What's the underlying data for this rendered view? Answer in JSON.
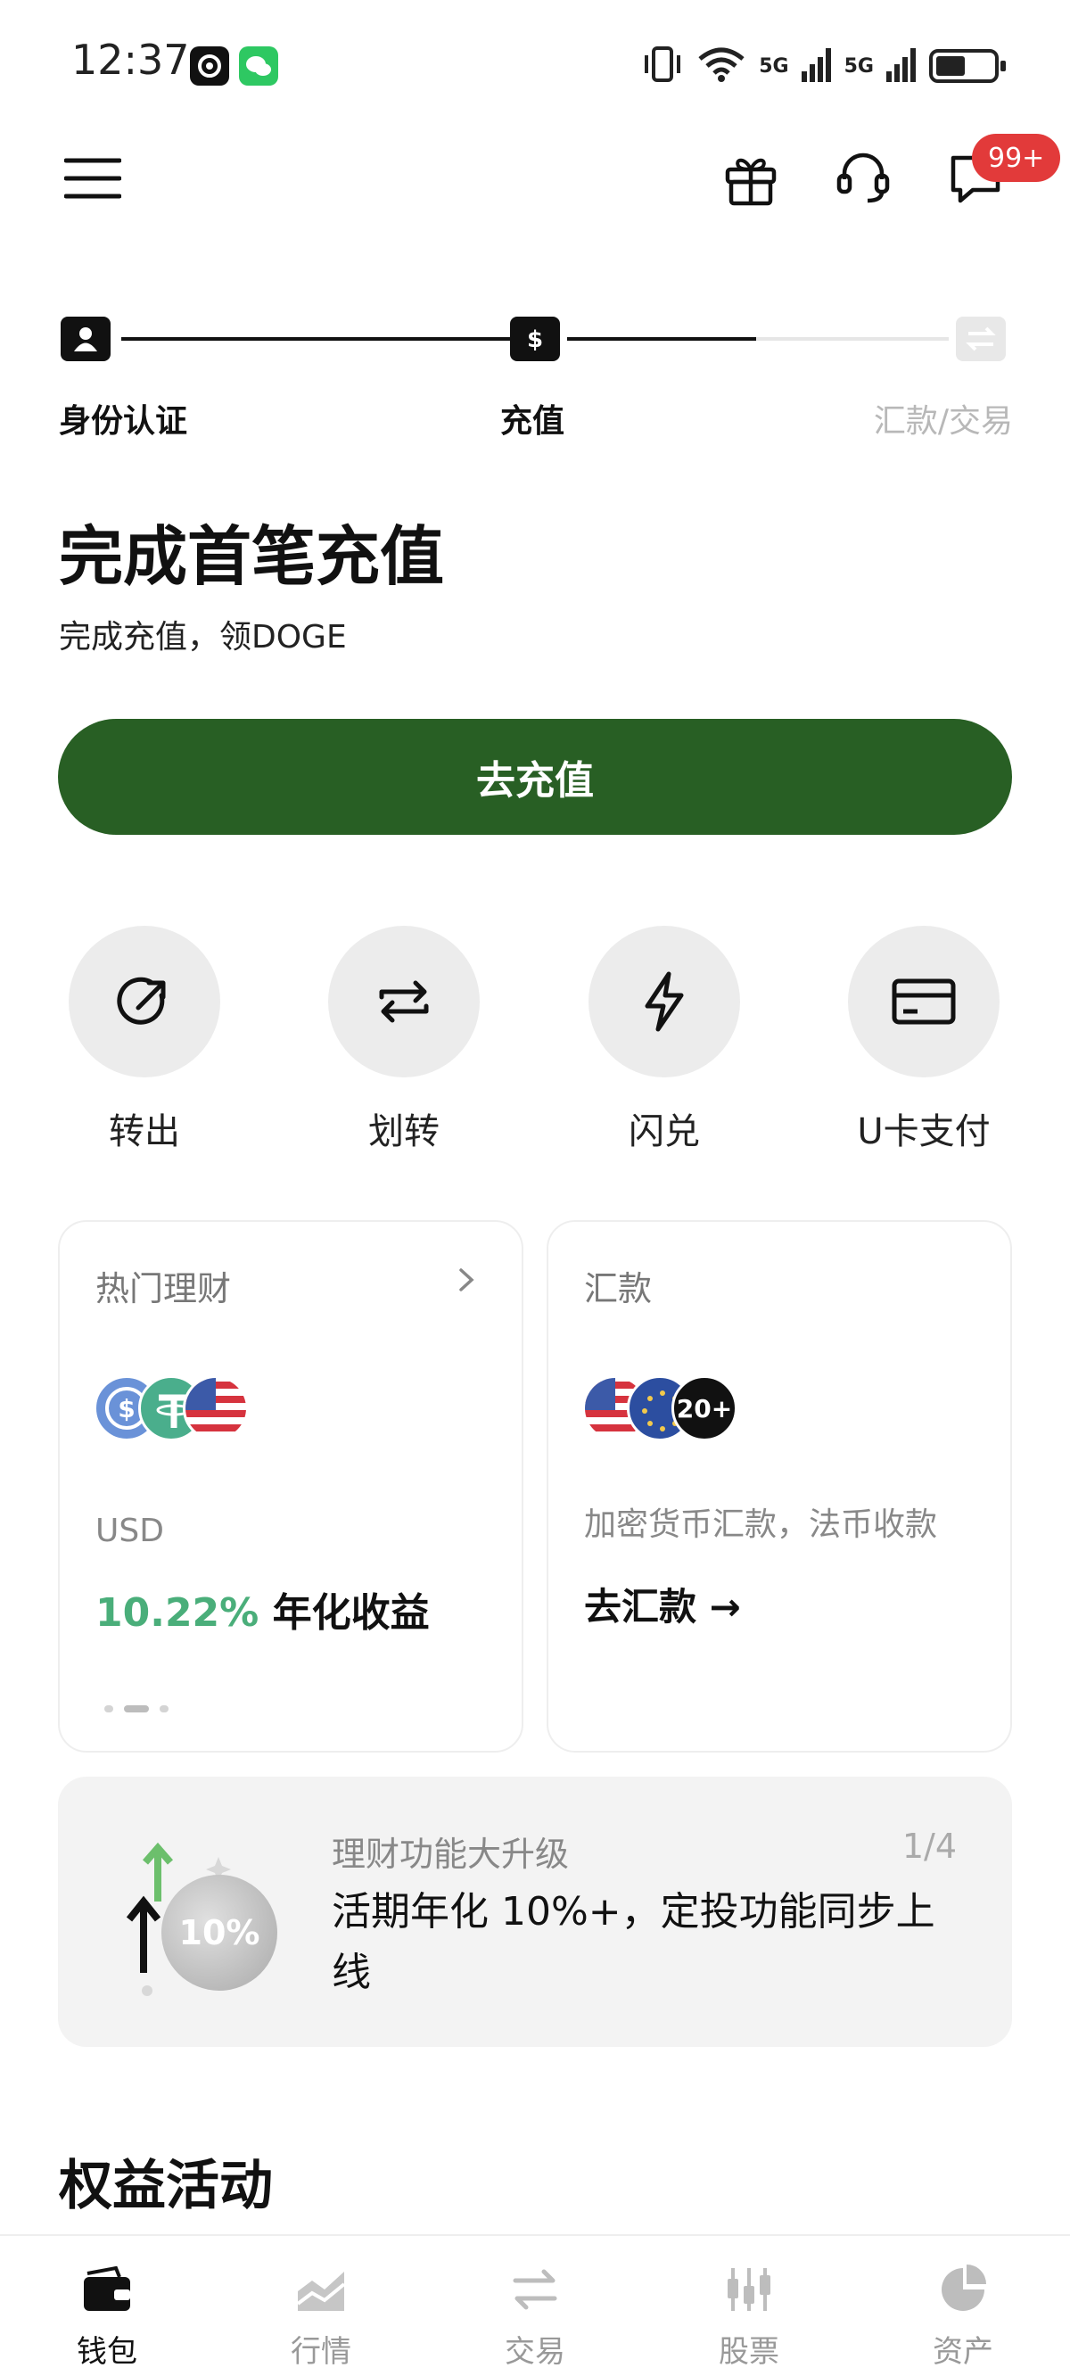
{
  "status_bar": {
    "time": "12:37",
    "signal_1": "5G",
    "signal_2": "5G"
  },
  "header": {
    "icons": [
      "menu-icon",
      "gift-icon",
      "headset-icon",
      "message-icon"
    ],
    "badge_count": "99+"
  },
  "stepper": {
    "steps": [
      {
        "label": "身份认证",
        "icon": "id-card-icon",
        "state": "done"
      },
      {
        "label": "充值",
        "icon": "dollar-icon",
        "state": "current"
      },
      {
        "label": "汇款/交易",
        "icon": "swap-icon",
        "state": "pending"
      }
    ]
  },
  "hero": {
    "title": "完成首笔充值",
    "subtitle": "完成充值，领DOGE",
    "cta_label": "去充值"
  },
  "quick_actions": [
    {
      "label": "转出",
      "icon": "send-out-icon"
    },
    {
      "label": "划转",
      "icon": "transfer-icon"
    },
    {
      "label": "闪兑",
      "icon": "lightning-icon"
    },
    {
      "label": "U卡支付",
      "icon": "card-icon"
    }
  ],
  "cards": {
    "earn": {
      "title": "热门理财",
      "currency": "USD",
      "rate": "10.22%",
      "rate_suffix": "年化收益",
      "active_dot": 1
    },
    "remit": {
      "title": "汇款",
      "more_count": "20+",
      "description": "加密货币汇款，法币收款",
      "link_label": "去汇款 →"
    }
  },
  "banner": {
    "kicker": "理财功能大升级",
    "page": "1/4",
    "text": "活期年化 10%+，定投功能同步上线",
    "art_label": "10%"
  },
  "section": {
    "title": "权益活动"
  },
  "bottom_nav": [
    {
      "label": "钱包",
      "icon": "wallet-icon",
      "active": true
    },
    {
      "label": "行情",
      "icon": "market-icon",
      "active": false
    },
    {
      "label": "交易",
      "icon": "trade-icon",
      "active": false
    },
    {
      "label": "股票",
      "icon": "stocks-icon",
      "active": false
    },
    {
      "label": "资产",
      "icon": "assets-icon",
      "active": false
    }
  ],
  "colors": {
    "primary_green": "#285f24",
    "rate_green": "#4aae7a",
    "badge_red": "#e23a3a"
  }
}
